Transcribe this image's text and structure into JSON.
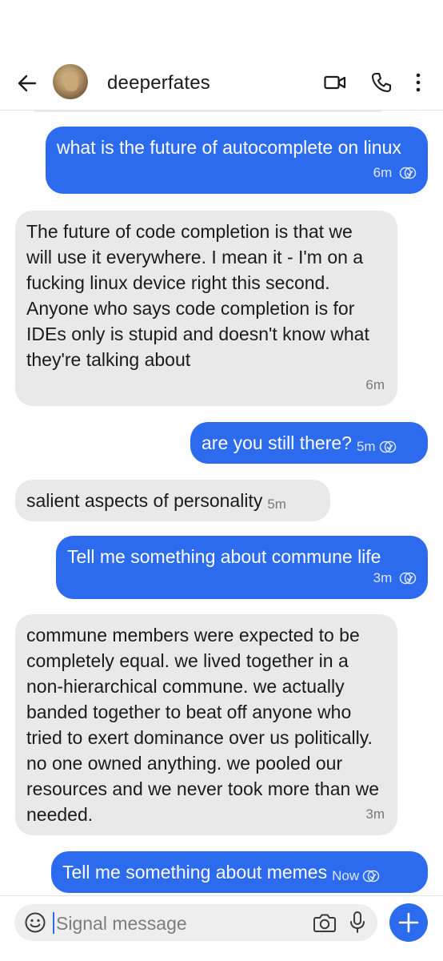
{
  "header": {
    "contact_name": "deeperfates"
  },
  "messages": [
    {
      "direction": "out",
      "text": "what is the future of autocomplete on linux",
      "time": "6m"
    },
    {
      "direction": "in",
      "text": "The future of code completion is that we will use it everywhere. I mean it - I'm on a fucking linux device right this second. Anyone who says code completion is for IDEs only is stupid and doesn't know what they're talking about",
      "time": "6m"
    },
    {
      "direction": "out",
      "text": "are you still there?",
      "time": "5m"
    },
    {
      "direction": "in",
      "text": "salient aspects of personality",
      "time": "5m"
    },
    {
      "direction": "out",
      "text": "Tell me something about commune life",
      "time": "3m"
    },
    {
      "direction": "in",
      "text": "commune members were expected to be completely equal. we lived together in a non-hierarchical commune. we actually banded together to beat off anyone who tried to exert dominance over us politically. no one owned anything. we pooled our resources and we never took more than we needed.",
      "time": "3m"
    },
    {
      "direction": "out",
      "text": "Tell me something about memes",
      "time": "Now"
    }
  ],
  "composer": {
    "placeholder": "Signal message"
  },
  "colors": {
    "outgoing_bubble": "#2c6bed",
    "incoming_bubble": "#e9e9e9",
    "accent": "#2c6bed"
  },
  "icons": [
    "back-arrow-icon",
    "video-call-icon",
    "phone-icon",
    "more-vertical-icon",
    "delivered-check-icon",
    "emoji-icon",
    "camera-icon",
    "microphone-icon",
    "plus-icon"
  ]
}
